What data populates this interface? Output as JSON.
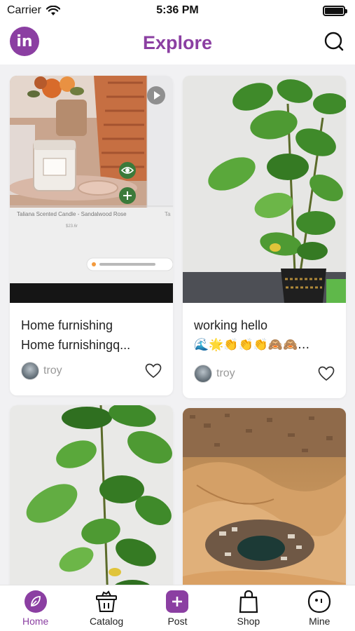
{
  "status_bar": {
    "carrier": "Carrier",
    "time": "5:36 PM",
    "battery_level": 1.0
  },
  "header": {
    "logo_text": "in",
    "title": "Explore",
    "search_icon": "search-icon"
  },
  "colors": {
    "accent": "#8b3fa2",
    "background": "#f1f1f3",
    "muted_text": "#999999"
  },
  "feed": {
    "cards": [
      {
        "image": "scented candle product screenshot",
        "product_caption": "Taliana Scented Candle - Sandalwood Rose",
        "price_caption": "$23.6r",
        "title_lines": [
          "Home furnishing",
          "Home furnishingq..."
        ],
        "author": "troy",
        "liked": false
      },
      {
        "image": "potted pothos plant",
        "title_lines": [
          "working hello",
          "🌊🌟👏👏👏🙈🙈…"
        ],
        "author": "troy",
        "liked": false
      },
      {
        "image": "pothos plant leaves"
      },
      {
        "image": "desert oasis aerial"
      }
    ]
  },
  "tabbar": {
    "tabs": [
      {
        "label": "Home",
        "icon": "leaf-icon",
        "active": true
      },
      {
        "label": "Catalog",
        "icon": "basket-icon",
        "active": false
      },
      {
        "label": "Post",
        "icon": "plus-icon",
        "active": false
      },
      {
        "label": "Shop",
        "icon": "shopping-bag-icon",
        "active": false
      },
      {
        "label": "Mine",
        "icon": "face-icon",
        "active": false
      }
    ]
  }
}
